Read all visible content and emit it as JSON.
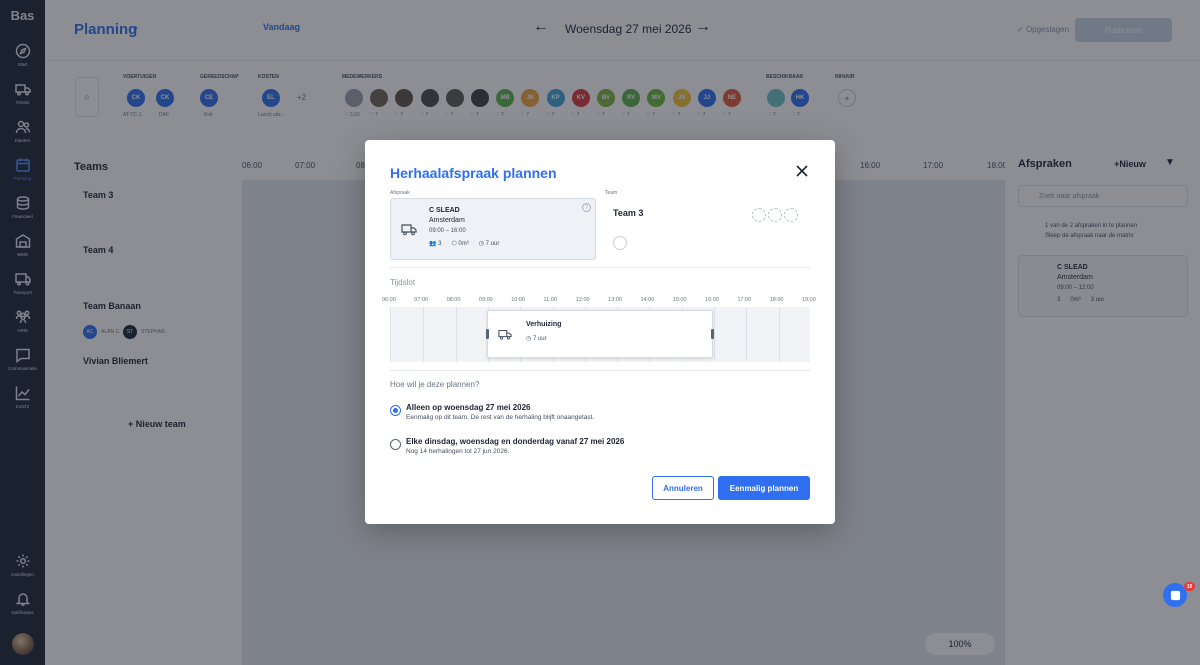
{
  "sidebar": {
    "brand": "Bas",
    "items": [
      {
        "label": "Start",
        "icon": "compass-icon"
      },
      {
        "label": "Tickets",
        "icon": "truck-icon"
      },
      {
        "label": "Klanten",
        "icon": "users-icon"
      },
      {
        "label": "Planning",
        "icon": "calendar-icon"
      },
      {
        "label": "Financieel",
        "icon": "coins-icon"
      },
      {
        "label": "WMS",
        "icon": "warehouse-icon"
      },
      {
        "label": "Transport",
        "icon": "transport-icon"
      },
      {
        "label": "HRM",
        "icon": "people-icon"
      },
      {
        "label": "Communicatie",
        "icon": "chat-icon"
      },
      {
        "label": "Inzicht",
        "icon": "chart-icon"
      }
    ],
    "bottom": [
      {
        "label": "Instellingen",
        "icon": "gear-icon"
      },
      {
        "label": "Notificaties",
        "icon": "bell-icon"
      }
    ]
  },
  "topbar": {
    "title": "Planning",
    "today": "Vandaag",
    "date": "Woensdag 27 mei 2026",
    "saved": "Opgeslagen",
    "publish": "Publiceren"
  },
  "resources": {
    "groups": [
      "Voertuigen",
      "Gereedschap",
      "Kosten",
      "Medewerkers",
      "Beschikbaar",
      "Inhuur"
    ],
    "vehicles": [
      {
        "initials": "CK",
        "caption": "AT-TC-1"
      },
      {
        "initials": "CK",
        "caption": "DAF"
      }
    ],
    "tools": [
      {
        "initials": "CE",
        "caption": "Kist"
      }
    ],
    "costs": [
      {
        "initials": "EL",
        "caption": "Lunch uitz..."
      }
    ],
    "costs_more": "+2",
    "staff_caption": "7",
    "staff_first_caption": "0,33",
    "staff": [
      {
        "initials": "",
        "color": "#9aa1ad"
      },
      {
        "initials": "",
        "color": "#6f6456"
      },
      {
        "initials": "",
        "color": "#5e5148"
      },
      {
        "initials": "",
        "color": "#4a4b4f"
      },
      {
        "initials": "",
        "color": "#5c5a55"
      },
      {
        "initials": "",
        "color": "#3d3f44"
      },
      {
        "initials": "MB",
        "color": "#5db34c"
      },
      {
        "initials": "JK",
        "color": "#f0a53b"
      },
      {
        "initials": "KP",
        "color": "#3fa7d8"
      },
      {
        "initials": "KV",
        "color": "#d93c3c"
      },
      {
        "initials": "BV",
        "color": "#7cb342"
      },
      {
        "initials": "RV",
        "color": "#5db34c"
      },
      {
        "initials": "MV",
        "color": "#68b83a"
      },
      {
        "initials": "JS",
        "color": "#f2c33a"
      },
      {
        "initials": "JJ",
        "color": "#2f6ff0"
      },
      {
        "initials": "NE",
        "color": "#e05a3a"
      }
    ],
    "available": [
      {
        "initials": "",
        "color": "#6cc3c7"
      },
      {
        "initials": "HK",
        "color": "#2f6ff0"
      }
    ]
  },
  "main": {
    "teams_title": "Teams",
    "hours": [
      "06:00",
      "07:00",
      "08:00",
      "16:00",
      "17:00",
      "18:00"
    ],
    "teams": [
      "Team 3",
      "Team 4",
      "Team Banaan",
      "Vivian Bliemert"
    ],
    "team_banaan_members": [
      "ALAN C.",
      "STEPHAN"
    ],
    "new_team": "Nieuw team",
    "zoom": "100%"
  },
  "right_panel": {
    "title": "Afspraken",
    "new": "Nieuw",
    "search_placeholder": "Zoek naar afspraak",
    "info_1": "1 van de 2 afspraken in te plannen",
    "info_2": "Sleep de afspraak naar de matrix",
    "card_name": "C SLEAD",
    "card_city": "Amsterdam",
    "card_time": "09:00 – 12:00",
    "card_people": "3",
    "card_volume": "0m³",
    "card_duration": "3 uur"
  },
  "dialog": {
    "title": "Herhaalafspraak plannen",
    "appt_label": "Afspraak",
    "team_label": "Team",
    "appt": {
      "name": "C SLEAD",
      "city": "Amsterdam",
      "time": "09:00 – 16:00",
      "people": "3",
      "volume": "0m³",
      "duration": "7 uur"
    },
    "team": "Team 3",
    "tijdslot": "Tijdslot",
    "tl_hours": [
      "06:00",
      "07:00",
      "08:00",
      "09:00",
      "10:00",
      "11:00",
      "12:00",
      "13:00",
      "14:00",
      "15:00",
      "16:00",
      "17:00",
      "18:00",
      "19:00"
    ],
    "block_name": "Verhuizing",
    "block_duration": "7 uur",
    "question": "Hoe wil je deze plannen?",
    "option1_title": "Alleen op woensdag 27 mei 2026",
    "option1_desc": "Eenmalig op dit team. De rest van de herhaling blijft onaangetast.",
    "option2_title": "Elke dinsdag, woensdag en donderdag vanaf 27 mei 2026",
    "option2_desc": "Nog 14 herhalingen tot 27 jun 2026.",
    "cancel": "Annuleren",
    "confirm": "Eenmalig plannen"
  },
  "chat": {
    "badge": "10"
  },
  "colors": {
    "accent": "#2f6ff0",
    "sidebar": "#1b2437"
  }
}
